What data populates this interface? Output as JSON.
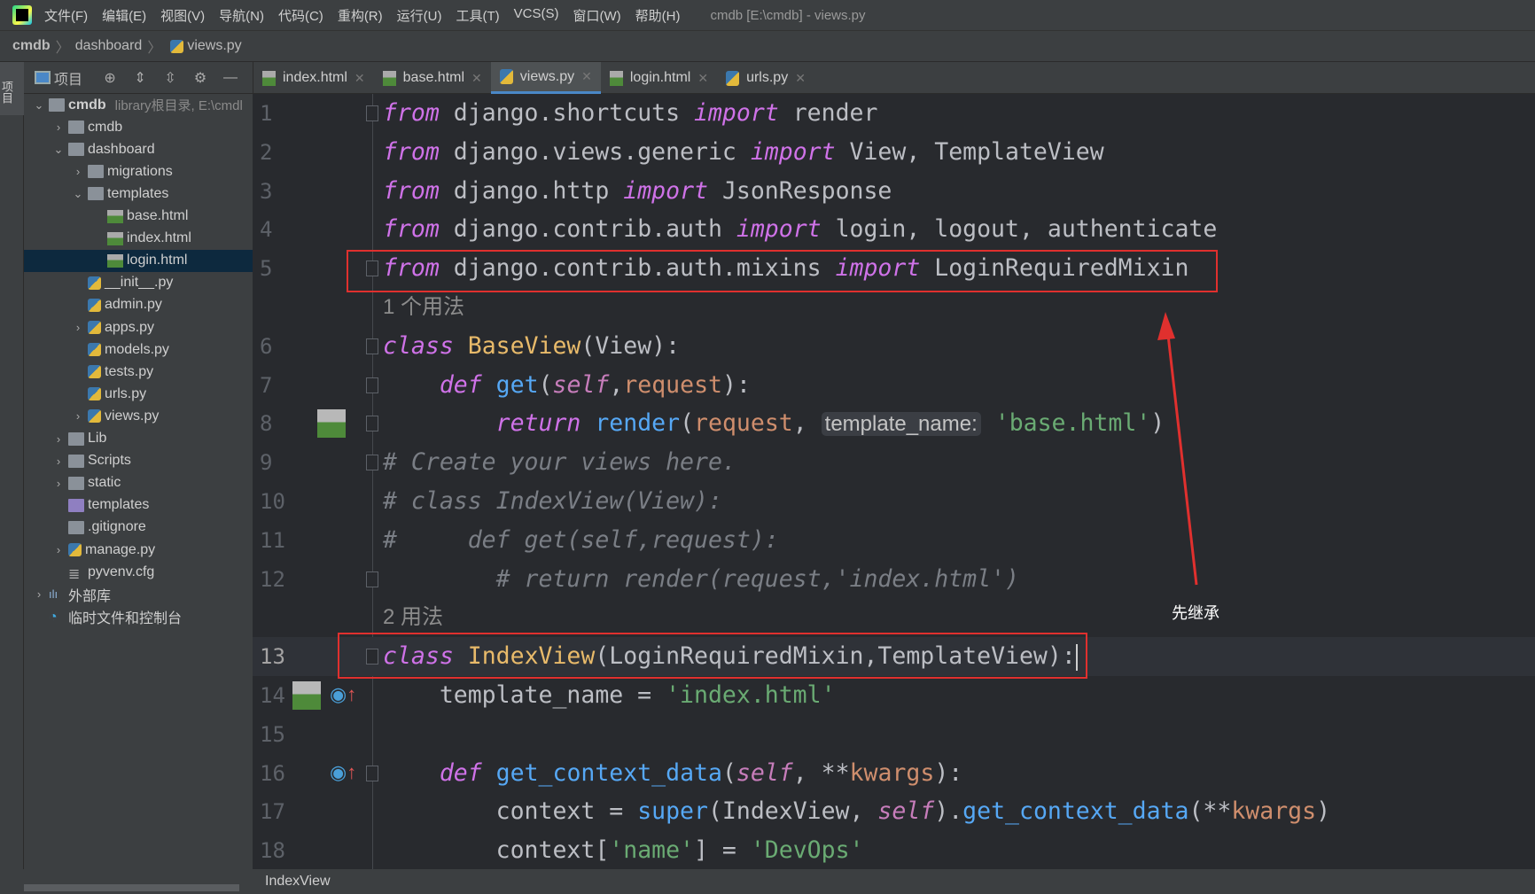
{
  "menubar": {
    "items": [
      "文件(F)",
      "编辑(E)",
      "视图(V)",
      "导航(N)",
      "代码(C)",
      "重构(R)",
      "运行(U)",
      "工具(T)",
      "VCS(S)",
      "窗口(W)",
      "帮助(H)"
    ],
    "window_title": "cmdb [E:\\cmdb] - views.py"
  },
  "breadcrumb": [
    "cmdb",
    "dashboard",
    "views.py"
  ],
  "left_strip": {
    "project_tab": "项目"
  },
  "project_panel": {
    "title": "项目"
  },
  "tree": [
    {
      "label": "cmdb",
      "hint": "library根目录, E:\\cmdl",
      "level": 0,
      "chev": "down",
      "icon": "folder",
      "bold": true
    },
    {
      "label": "cmdb",
      "level": 1,
      "chev": "right",
      "icon": "folder"
    },
    {
      "label": "dashboard",
      "level": 1,
      "chev": "down",
      "icon": "folder"
    },
    {
      "label": "migrations",
      "level": 2,
      "chev": "right",
      "icon": "folder"
    },
    {
      "label": "templates",
      "level": 2,
      "chev": "down",
      "icon": "folder"
    },
    {
      "label": "base.html",
      "level": 3,
      "icon": "html"
    },
    {
      "label": "index.html",
      "level": 3,
      "icon": "html"
    },
    {
      "label": "login.html",
      "level": 3,
      "icon": "html",
      "selected": true
    },
    {
      "label": "__init__.py",
      "level": 2,
      "icon": "py"
    },
    {
      "label": "admin.py",
      "level": 2,
      "icon": "py"
    },
    {
      "label": "apps.py",
      "level": 2,
      "chev": "right",
      "icon": "py"
    },
    {
      "label": "models.py",
      "level": 2,
      "icon": "py"
    },
    {
      "label": "tests.py",
      "level": 2,
      "icon": "py"
    },
    {
      "label": "urls.py",
      "level": 2,
      "icon": "py"
    },
    {
      "label": "views.py",
      "level": 2,
      "chev": "right",
      "icon": "py"
    },
    {
      "label": "Lib",
      "level": 1,
      "chev": "right",
      "icon": "folder"
    },
    {
      "label": "Scripts",
      "level": 1,
      "chev": "right",
      "icon": "folder"
    },
    {
      "label": "static",
      "level": 1,
      "chev": "right",
      "icon": "folder"
    },
    {
      "label": "templates",
      "level": 1,
      "icon": "folder-purple"
    },
    {
      "label": ".gitignore",
      "level": 1,
      "icon": "file"
    },
    {
      "label": "manage.py",
      "level": 1,
      "chev": "right",
      "icon": "py"
    },
    {
      "label": "pyvenv.cfg",
      "level": 1,
      "icon": "cfg"
    },
    {
      "label": "外部库",
      "level": 0,
      "chev": "right",
      "icon": "library"
    },
    {
      "label": "临时文件和控制台",
      "level": 0,
      "icon": "scratch"
    }
  ],
  "tabs": [
    {
      "label": "index.html",
      "icon": "html"
    },
    {
      "label": "base.html",
      "icon": "html"
    },
    {
      "label": "views.py",
      "icon": "py",
      "active": true
    },
    {
      "label": "login.html",
      "icon": "html"
    },
    {
      "label": "urls.py",
      "icon": "py"
    }
  ],
  "code_rows": [
    {
      "n": "1",
      "fold": true,
      "tokens": [
        [
          "from",
          "kw"
        ],
        [
          " django.shortcuts ",
          ""
        ],
        [
          "import",
          "kw"
        ],
        [
          " render",
          ""
        ]
      ]
    },
    {
      "n": "2",
      "tokens": [
        [
          "from",
          "kw"
        ],
        [
          " django.views.generic ",
          ""
        ],
        [
          "import",
          "kw"
        ],
        [
          " View, TemplateView",
          ""
        ]
      ]
    },
    {
      "n": "3",
      "tokens": [
        [
          "from",
          "kw"
        ],
        [
          " django.http ",
          ""
        ],
        [
          "import",
          "kw"
        ],
        [
          " JsonResponse",
          ""
        ]
      ]
    },
    {
      "n": "4",
      "tokens": [
        [
          "from",
          "kw"
        ],
        [
          " django.contrib.auth ",
          ""
        ],
        [
          "import",
          "kw"
        ],
        [
          " login, logout, authenticate",
          ""
        ]
      ]
    },
    {
      "n": "5",
      "fold": true,
      "tokens": [
        [
          "from",
          "kw"
        ],
        [
          " django.contrib.auth.mixins ",
          ""
        ],
        [
          "import",
          "kw"
        ],
        [
          " LoginRequiredMixin",
          ""
        ]
      ]
    },
    {
      "inlay": "1 个用法"
    },
    {
      "n": "6",
      "fold": true,
      "tokens": [
        [
          "class",
          "kw"
        ],
        [
          " ",
          ""
        ],
        [
          "BaseView",
          "cls"
        ],
        [
          "(View):",
          ""
        ]
      ]
    },
    {
      "n": "7",
      "fold": true,
      "tokens": [
        [
          "    ",
          ""
        ],
        [
          "def",
          "kw"
        ],
        [
          " ",
          ""
        ],
        [
          "get",
          "fn"
        ],
        [
          "(",
          ""
        ],
        [
          "self",
          "slf"
        ],
        [
          ",",
          ""
        ],
        [
          "request",
          "par"
        ],
        [
          "):",
          ""
        ]
      ]
    },
    {
      "n": "8",
      "fold": true,
      "gutter": [
        "html"
      ],
      "tokens": [
        [
          "        ",
          ""
        ],
        [
          "return",
          "kw"
        ],
        [
          " ",
          ""
        ],
        [
          "render",
          "fn"
        ],
        [
          "(",
          ""
        ],
        [
          "request",
          "par"
        ],
        [
          ", ",
          ""
        ],
        [
          "template_name:",
          "hint"
        ],
        [
          " ",
          ""
        ],
        [
          "'base.html'",
          "str"
        ],
        [
          ")",
          ""
        ]
      ]
    },
    {
      "n": "9",
      "fold": true,
      "tokens": [
        [
          "# Create your views here.",
          "cmt"
        ]
      ]
    },
    {
      "n": "10",
      "tokens": [
        [
          "# class IndexView(View):",
          "cmt"
        ]
      ]
    },
    {
      "n": "11",
      "tokens": [
        [
          "#     def get(self,request):",
          "cmt"
        ]
      ]
    },
    {
      "n": "12",
      "fold": true,
      "tokens": [
        [
          "        # return render(request,'index.html')",
          "cmt"
        ]
      ]
    },
    {
      "inlay": "2 用法"
    },
    {
      "n": "13",
      "fold": true,
      "current": true,
      "tokens": [
        [
          "class",
          "kw"
        ],
        [
          " ",
          ""
        ],
        [
          "IndexView",
          "cls"
        ],
        [
          "(LoginRequiredMixin,TemplateView):",
          ""
        ]
      ]
    },
    {
      "n": "14",
      "gutter": [
        "html",
        "override"
      ],
      "tokens": [
        [
          "    template_name = ",
          ""
        ],
        [
          "'index.html'",
          "str"
        ]
      ]
    },
    {
      "n": "15",
      "tokens": []
    },
    {
      "n": "16",
      "fold": true,
      "gutter": [
        "override"
      ],
      "tokens": [
        [
          "    ",
          ""
        ],
        [
          "def",
          "kw"
        ],
        [
          " ",
          ""
        ],
        [
          "get_context_data",
          "fn"
        ],
        [
          "(",
          ""
        ],
        [
          "self",
          "slf"
        ],
        [
          ", **",
          ""
        ],
        [
          "kwargs",
          "par"
        ],
        [
          "):",
          ""
        ]
      ]
    },
    {
      "n": "17",
      "tokens": [
        [
          "        context = ",
          ""
        ],
        [
          "super",
          "bi"
        ],
        [
          "(IndexView, ",
          ""
        ],
        [
          "self",
          "slf"
        ],
        [
          ").",
          ""
        ],
        [
          "get_context_data",
          "fn"
        ],
        [
          "(**",
          ""
        ],
        [
          "kwargs",
          "par"
        ],
        [
          ")",
          ""
        ]
      ]
    },
    {
      "n": "18",
      "tokens": [
        [
          "        context[",
          ""
        ],
        [
          "'name'",
          "str"
        ],
        [
          "] = ",
          ""
        ],
        [
          "'DevOps'",
          "str"
        ]
      ]
    }
  ],
  "annotation": {
    "text": "先继承",
    "color": "#e0302e"
  },
  "statusbar": {
    "context": "IndexView"
  }
}
